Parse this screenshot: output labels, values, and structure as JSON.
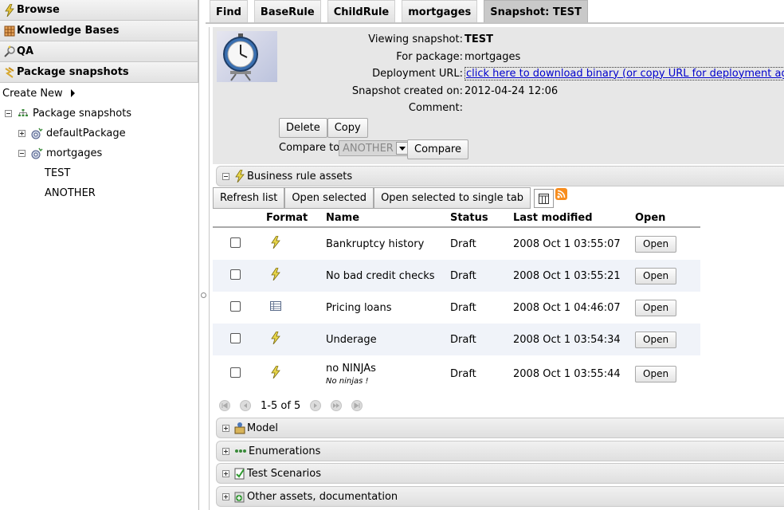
{
  "nav": {
    "sections": [
      {
        "label": "Browse",
        "icon": "browse-icon"
      },
      {
        "label": "Knowledge Bases",
        "icon": "knowledge-bases-icon"
      },
      {
        "label": "QA",
        "icon": "qa-icon"
      },
      {
        "label": "Package snapshots",
        "icon": "package-snapshots-icon"
      }
    ],
    "create_new": "Create New",
    "tree": {
      "root": "Package snapshots",
      "items": [
        "defaultPackage",
        "mortgages"
      ],
      "children": [
        "TEST",
        "ANOTHER"
      ]
    }
  },
  "tabs": [
    "Find",
    "BaseRule",
    "ChildRule",
    "mortgages",
    "Snapshot: TEST"
  ],
  "snapshot": {
    "viewing_label": "Viewing snapshot:",
    "viewing_value": "TEST",
    "package_label": "For package:",
    "package_value": "mortgages",
    "url_label": "Deployment URL:",
    "url_link": "click here to download binary (or copy URL for deployment agent)",
    "created_label": "Snapshot created on:",
    "created_value": "2012-04-24 12:06",
    "comment_label": "Comment:",
    "comment_value": "",
    "delete_btn": "Delete",
    "copy_btn": "Copy",
    "compare_label": "Compare to:",
    "compare_selected": "ANOTHER",
    "compare_btn": "Compare"
  },
  "assets": {
    "section_title": "Business rule assets",
    "toolbar": [
      "Refresh list",
      "Open selected",
      "Open selected to single tab"
    ],
    "columns": [
      "Format",
      "Name",
      "Status",
      "Last modified",
      "Open"
    ],
    "rows": [
      {
        "format": "rule-icon",
        "name": "Bankruptcy history",
        "description": "",
        "status": "Draft",
        "modified": "2008 Oct 1 03:55:07",
        "open": "Open"
      },
      {
        "format": "rule-icon",
        "name": "No bad credit checks",
        "description": "",
        "status": "Draft",
        "modified": "2008 Oct 1 03:55:21",
        "open": "Open"
      },
      {
        "format": "decision-table-icon",
        "name": "Pricing loans",
        "description": "",
        "status": "Draft",
        "modified": "2008 Oct 1 04:46:07",
        "open": "Open"
      },
      {
        "format": "rule-icon",
        "name": "Underage",
        "description": "",
        "status": "Draft",
        "modified": "2008 Oct 1 03:54:34",
        "open": "Open"
      },
      {
        "format": "rule-icon",
        "name": "no NINJAs",
        "description": "No ninjas !",
        "status": "Draft",
        "modified": "2008 Oct 1 03:55:44",
        "open": "Open"
      }
    ],
    "pager": "1-5 of 5"
  },
  "sections": [
    "Model",
    "Enumerations",
    "Test Scenarios",
    "Other assets, documentation"
  ],
  "colors": {
    "link": "#0000cc",
    "rss": "#f78d1e",
    "alt_row": "#f0f3f9"
  }
}
